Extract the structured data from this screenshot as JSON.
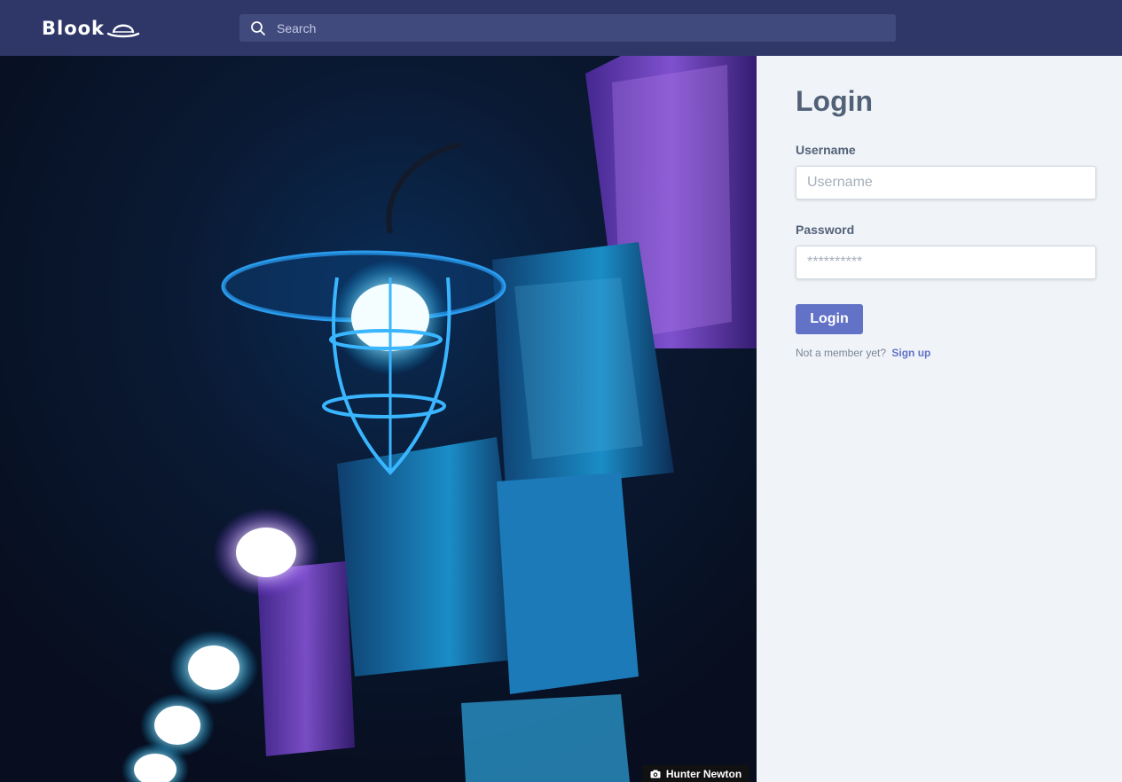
{
  "header": {
    "logo_text": "Blook",
    "search_placeholder": "Search"
  },
  "photo": {
    "credit": "Hunter Newton"
  },
  "login": {
    "title": "Login",
    "username_label": "Username",
    "username_placeholder": "Username",
    "password_label": "Password",
    "password_placeholder": "**********",
    "submit_label": "Login",
    "prompt_text": "Not a member yet?",
    "signup_link": "Sign up"
  },
  "colors": {
    "header_bg": "#2f3768",
    "search_bg": "#414a7c",
    "panel_bg": "#f0f4f8",
    "accent": "#6272c6",
    "heading_text": "#536178"
  },
  "icons": [
    "hat-logo-icon",
    "search-icon",
    "camera-icon"
  ]
}
